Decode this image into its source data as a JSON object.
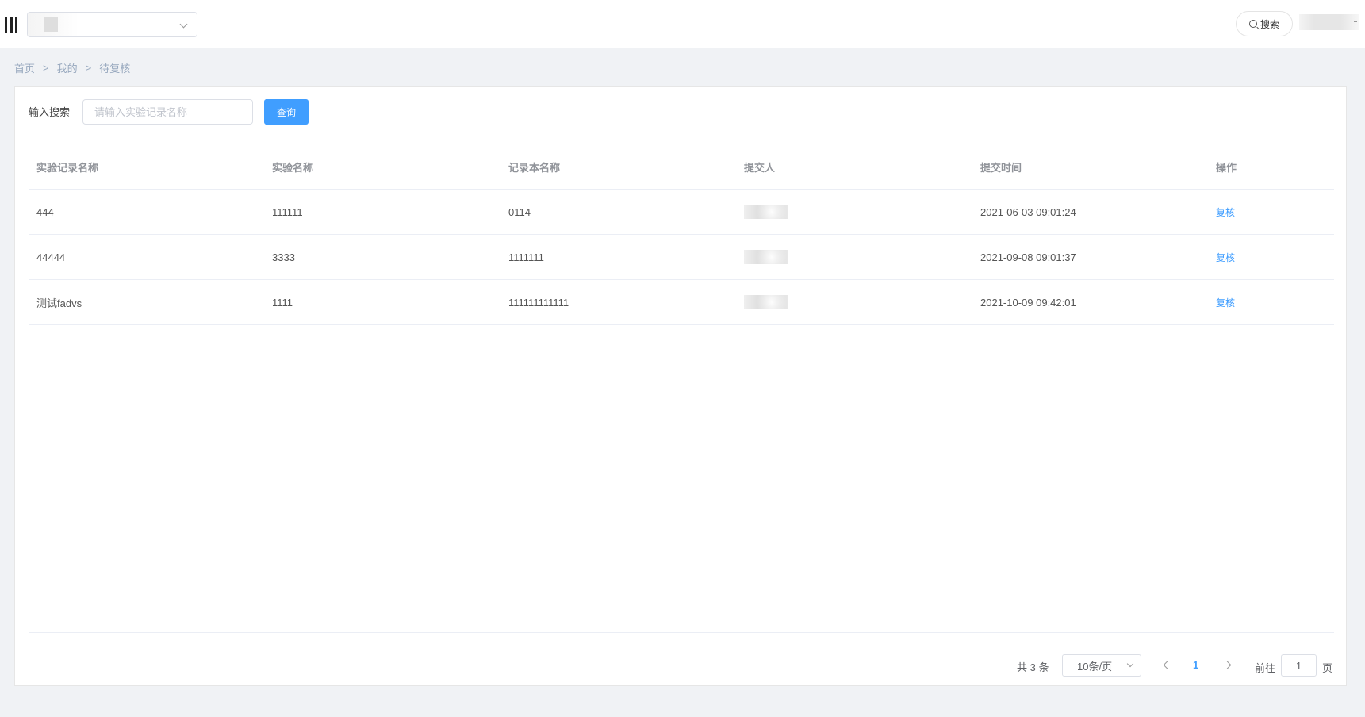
{
  "header": {
    "search_label": "搜索"
  },
  "breadcrumb": {
    "items": [
      "首页",
      "我的",
      "待复核"
    ],
    "separator": ">"
  },
  "filter": {
    "label": "输入搜索",
    "placeholder": "请输入实验记录名称",
    "value": "",
    "query_button": "查询"
  },
  "table": {
    "columns": [
      "实验记录名称",
      "实验名称",
      "记录本名称",
      "提交人",
      "提交时间",
      "操作"
    ],
    "rows": [
      {
        "record": "444",
        "experiment": "111111",
        "notebook": "0114",
        "submitter": "",
        "time": "2021-06-03 09:01:24",
        "action": "复核"
      },
      {
        "record": "44444",
        "experiment": "3333",
        "notebook": "1111111",
        "submitter": "",
        "time": "2021-09-08 09:01:37",
        "action": "复核"
      },
      {
        "record": "测试fadvs",
        "experiment": "1111",
        "notebook": "111111111111",
        "submitter": "",
        "time": "2021-10-09 09:42:01",
        "action": "复核"
      }
    ]
  },
  "pagination": {
    "total_text": "共 3 条",
    "page_size": "10条/页",
    "current_page": "1",
    "goto_label": "前往",
    "goto_value": "1",
    "goto_suffix": "页"
  },
  "colors": {
    "primary": "#409eff",
    "page_bg": "#f0f2f5",
    "header_text": "#909399"
  }
}
